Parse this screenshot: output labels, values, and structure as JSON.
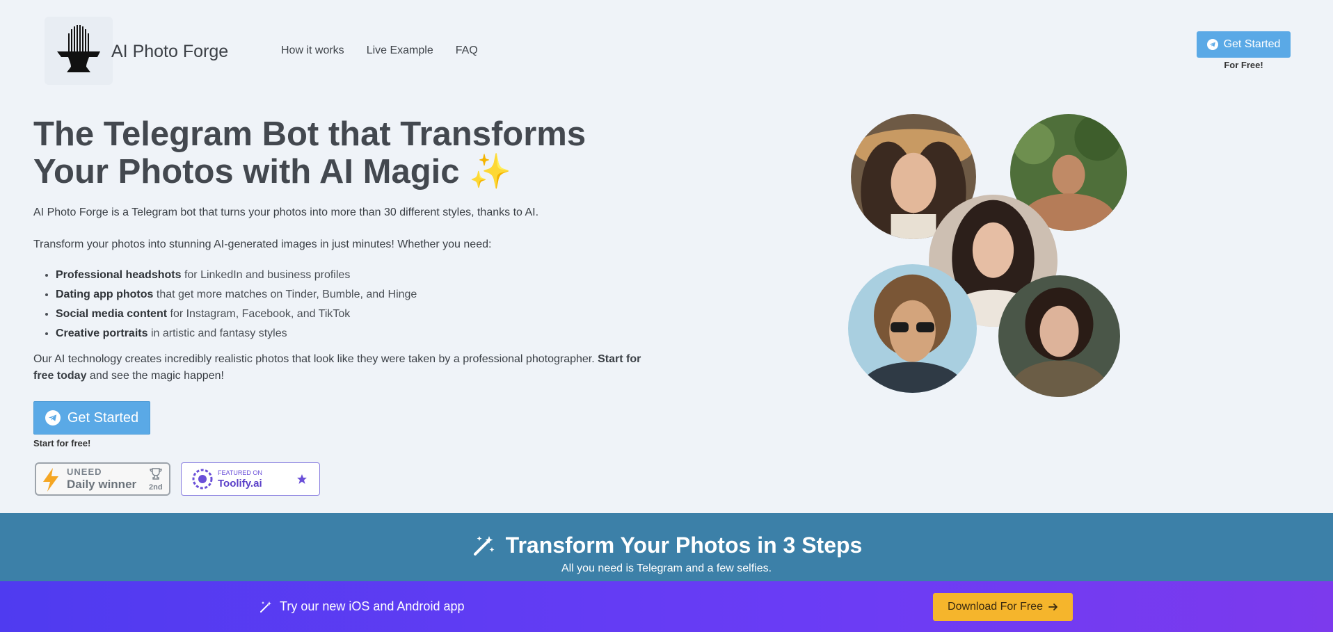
{
  "brand": {
    "name": "AI Photo Forge"
  },
  "nav": {
    "items": [
      "How it works",
      "Live Example",
      "FAQ"
    ]
  },
  "header_cta": {
    "label": "Get Started",
    "sub": "For Free!"
  },
  "hero": {
    "title": "The Telegram Bot that Transforms Your Photos with AI Magic ✨",
    "intro": "AI Photo Forge is a Telegram bot that turns your photos into more than 30 different styles, thanks to AI.",
    "lead": "Transform your photos into stunning AI-generated images in just minutes! Whether you need:",
    "bullets": [
      {
        "bold": "Professional headshots",
        "rest": " for LinkedIn and business profiles"
      },
      {
        "bold": "Dating app photos",
        "rest": " that get more matches on Tinder, Bumble, and Hinge"
      },
      {
        "bold": "Social media content",
        "rest": " for Instagram, Facebook, and TikTok"
      },
      {
        "bold": "Creative portraits",
        "rest": " in artistic and fantasy styles"
      }
    ],
    "closing_start": "Our AI technology creates incredibly realistic photos that look like they were taken by a professional photographer. ",
    "closing_bold": "Start for free today",
    "closing_end": " and see the magic happen!",
    "cta_label": "Get Started",
    "cta_sub": "Start for free!"
  },
  "badges": {
    "uneed": {
      "brand": "UNEED",
      "label": "Daily winner",
      "rank": "2nd"
    },
    "toolify": {
      "small": "FEATURED ON",
      "name": "Toolify.ai"
    }
  },
  "steps": {
    "title": "Transform Your Photos in 3 Steps",
    "subtitle": "All you need is Telegram and a few selfies."
  },
  "banner": {
    "text": "Try our new iOS and Android app",
    "button": "Download For Free"
  },
  "colors": {
    "accent": "#5aa9e6",
    "steps_bg": "#3c80a8",
    "banner_start": "#4f3bf0",
    "banner_end": "#7c3aed",
    "banner_btn": "#f5b52c"
  }
}
